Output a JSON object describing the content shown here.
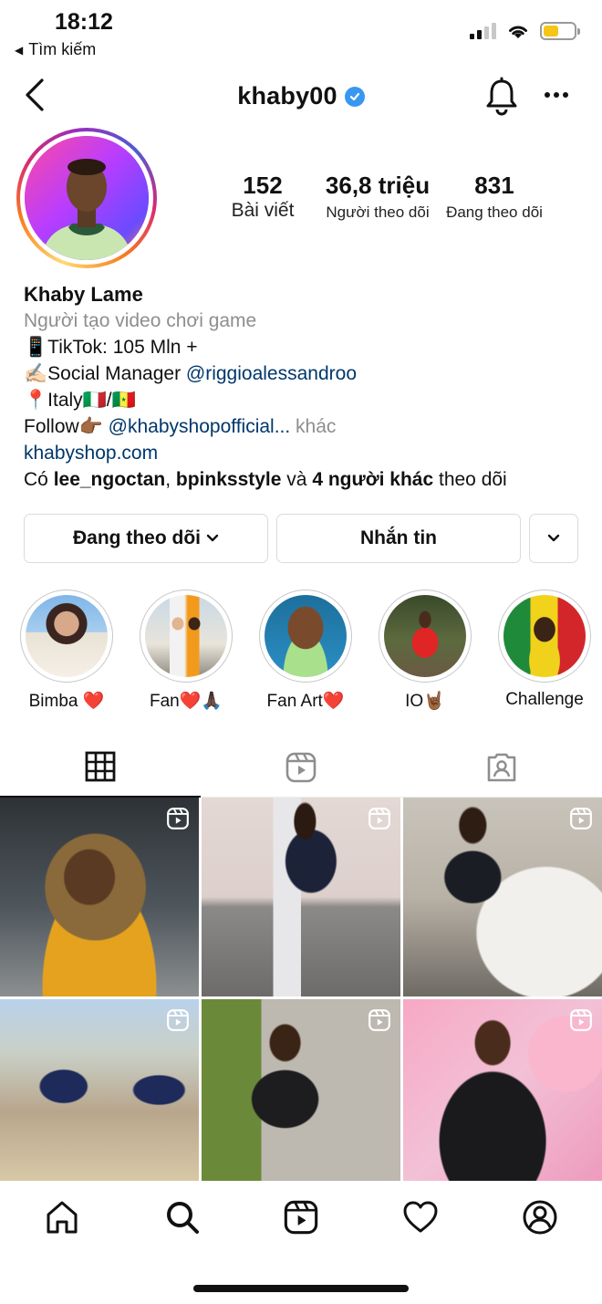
{
  "status_bar": {
    "time": "18:12",
    "back_app": "Tìm kiếm",
    "battery_color": "#f5c518",
    "battery_level": 0.5
  },
  "header": {
    "username": "khaby00",
    "verified": true
  },
  "profile": {
    "stats": {
      "posts_count": "152",
      "posts_label": "Bài viết",
      "followers_count": "36,8 triệu",
      "followers_label": "Người theo dõi",
      "following_count": "831",
      "following_label": "Đang theo dõi"
    },
    "bio": {
      "name": "Khaby Lame",
      "category": "Người tạo video chơi game",
      "line1": "📱TikTok: 105 Mln +",
      "line2_prefix": "✍🏻Social Manager ",
      "line2_mention": "@riggioalessandroo",
      "line3": "📍Italy🇮🇹/🇸🇳",
      "line4_prefix": "Follow👉🏾 ",
      "line4_mention": "@khabyshopofficial...",
      "line4_more": " khác",
      "website": "khabyshop.com",
      "followed_by_prefix": "Có ",
      "followed_by_user1": "lee_ngoctan",
      "followed_by_sep": ", ",
      "followed_by_user2": "bpinksstyle",
      "followed_by_and": " và ",
      "followed_by_others": "4 người khác",
      "followed_by_suffix": " theo dõi"
    }
  },
  "actions": {
    "following_label": "Đang theo dõi",
    "message_label": "Nhắn tin"
  },
  "highlights": [
    {
      "label": "Bimba ❤️"
    },
    {
      "label": "Fan❤️🙏🏿"
    },
    {
      "label": "Fan Art❤️"
    },
    {
      "label": "IO🤘🏾"
    },
    {
      "label": "Challenge"
    }
  ],
  "tabs": [
    "grid-icon",
    "reels-icon",
    "tagged-icon"
  ],
  "grid_posts": [
    {
      "type": "reel"
    },
    {
      "type": "reel"
    },
    {
      "type": "reel"
    },
    {
      "type": "reel"
    },
    {
      "type": "reel"
    },
    {
      "type": "reel"
    }
  ],
  "bottom_nav": [
    "home-icon",
    "search-icon",
    "reels-icon",
    "heart-icon",
    "profile-icon"
  ]
}
